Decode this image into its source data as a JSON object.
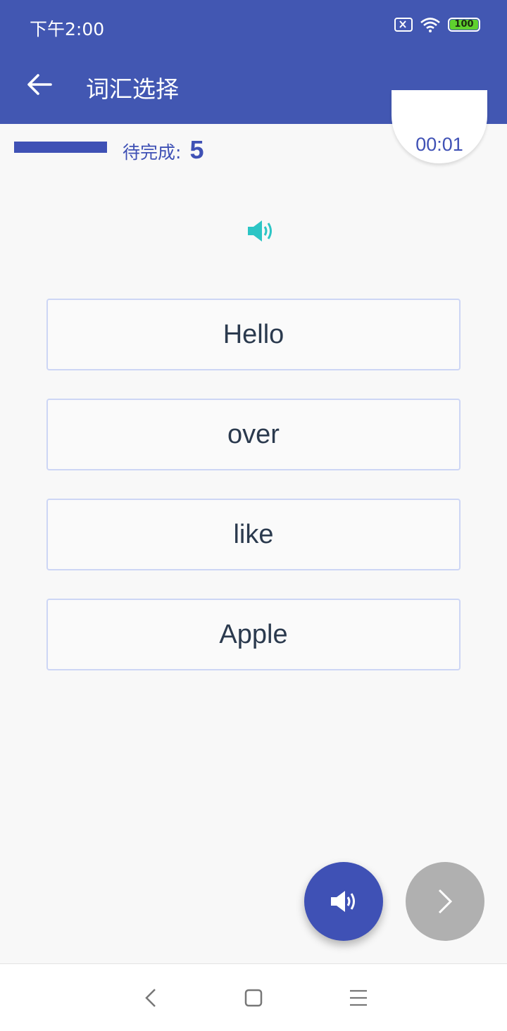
{
  "status_bar": {
    "time": "下午2:00",
    "battery": "100",
    "icons": [
      "sim-card-off-icon",
      "wifi-icon",
      "battery-icon"
    ]
  },
  "header": {
    "title": "词汇选择",
    "back_icon": "arrow-left-icon"
  },
  "progress": {
    "fraction": 1.0,
    "pending_label": "待完成:",
    "pending_count": "5"
  },
  "timer": "00:01",
  "audio_icon": "speaker-icon",
  "options": [
    {
      "label": "Hello"
    },
    {
      "label": "over"
    },
    {
      "label": "like"
    },
    {
      "label": "Apple"
    }
  ],
  "fabs": {
    "play": "speaker-icon",
    "next": "chevron-right-icon"
  },
  "nav": [
    "back-icon",
    "home-icon",
    "menu-icon"
  ],
  "colors": {
    "primary": "#3f51b5",
    "appbar": "#4257b2",
    "accent": "#2cc5c5",
    "option_border": "#cdd6f5",
    "disabled": "#b0b0b0"
  }
}
